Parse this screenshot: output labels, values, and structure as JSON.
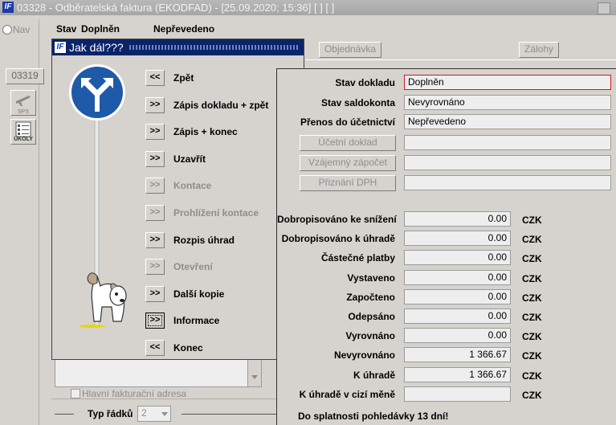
{
  "window": {
    "title": "03328 - Odběratelská faktura (EKODFAD) - [25.09.2020; 15:36]  [ ]  [ ]",
    "logo": "IF"
  },
  "left": {
    "nav_label": "Nav",
    "number_button": "03319",
    "sps_label": "SPS",
    "ukoly_label": "ÚKOLY"
  },
  "header": {
    "stav_label": "Stav",
    "stav_value": "Doplněn",
    "prevod_value": "Nepřevedeno"
  },
  "tabs": {
    "objednavka": "Objednávka",
    "zalohy": "Zálohy"
  },
  "dialog": {
    "title": "Jak dál???",
    "items": [
      {
        "btn": "<<",
        "label": "Zpět",
        "enabled": true
      },
      {
        "btn": ">>",
        "label": "Zápis dokladu + zpět",
        "enabled": true
      },
      {
        "btn": ">>",
        "label": "Zápis + konec",
        "enabled": true
      },
      {
        "btn": ">>",
        "label": "Uzavřít",
        "enabled": true
      },
      {
        "btn": ">>",
        "label": "Kontace",
        "enabled": false
      },
      {
        "btn": ">>",
        "label": "Prohlížení kontace",
        "enabled": false
      },
      {
        "btn": ">>",
        "label": "Rozpis úhrad",
        "enabled": true
      },
      {
        "btn": ">>",
        "label": "Otevření",
        "enabled": false
      },
      {
        "btn": ">>",
        "label": "Další kopie",
        "enabled": true
      },
      {
        "btn": ">>",
        "label": "Informace",
        "enabled": true
      },
      {
        "btn": "<<",
        "label": "Konec",
        "enabled": true
      }
    ]
  },
  "panel": {
    "stav_dokladu_label": "Stav dokladu",
    "stav_dokladu": "Doplněn",
    "stav_saldokonta_label": "Stav saldokonta",
    "stav_saldokonta": "Nevyrovnáno",
    "prenos_label": "Přenos do účetnictví",
    "prenos": "Nepřevedeno",
    "btn_ucetni": "Účetní doklad",
    "btn_vzajemny": "Vzájemný zápočet",
    "btn_dph": "Přiznání DPH",
    "amounts": [
      {
        "label": "Dobropisováno ke snížení",
        "value": "0.00",
        "currency": "CZK"
      },
      {
        "label": "Dobropisováno k úhradě",
        "value": "0.00",
        "currency": "CZK"
      },
      {
        "label": "Částečné platby",
        "value": "0.00",
        "currency": "CZK"
      },
      {
        "label": "Vystaveno",
        "value": "0.00",
        "currency": "CZK"
      },
      {
        "label": "Započteno",
        "value": "0.00",
        "currency": "CZK"
      },
      {
        "label": "Odepsáno",
        "value": "0.00",
        "currency": "CZK"
      },
      {
        "label": "Vyrovnáno",
        "value": "0.00",
        "currency": "CZK"
      },
      {
        "label": "Nevyrovnáno",
        "value": "1 366.67",
        "currency": "CZK"
      },
      {
        "label": "K úhradě",
        "value": "1 366.67",
        "currency": "CZK"
      },
      {
        "label": "K úhradě v cizí měně",
        "value": "",
        "currency": "CZK"
      }
    ],
    "footer_note": "Do splatnosti pohledávky 13 dní!"
  },
  "bottom": {
    "hlavni_adresa": "Hlavní fakturační adresa",
    "typ_radku_label": "Typ řádků",
    "typ_radku_value": "2"
  },
  "icons": {
    "nav": "radio-icon",
    "sps": "plane-icon",
    "ukoly": "checklist-icon",
    "sign": "turn-sign-icon",
    "dog": "dog-icon"
  }
}
